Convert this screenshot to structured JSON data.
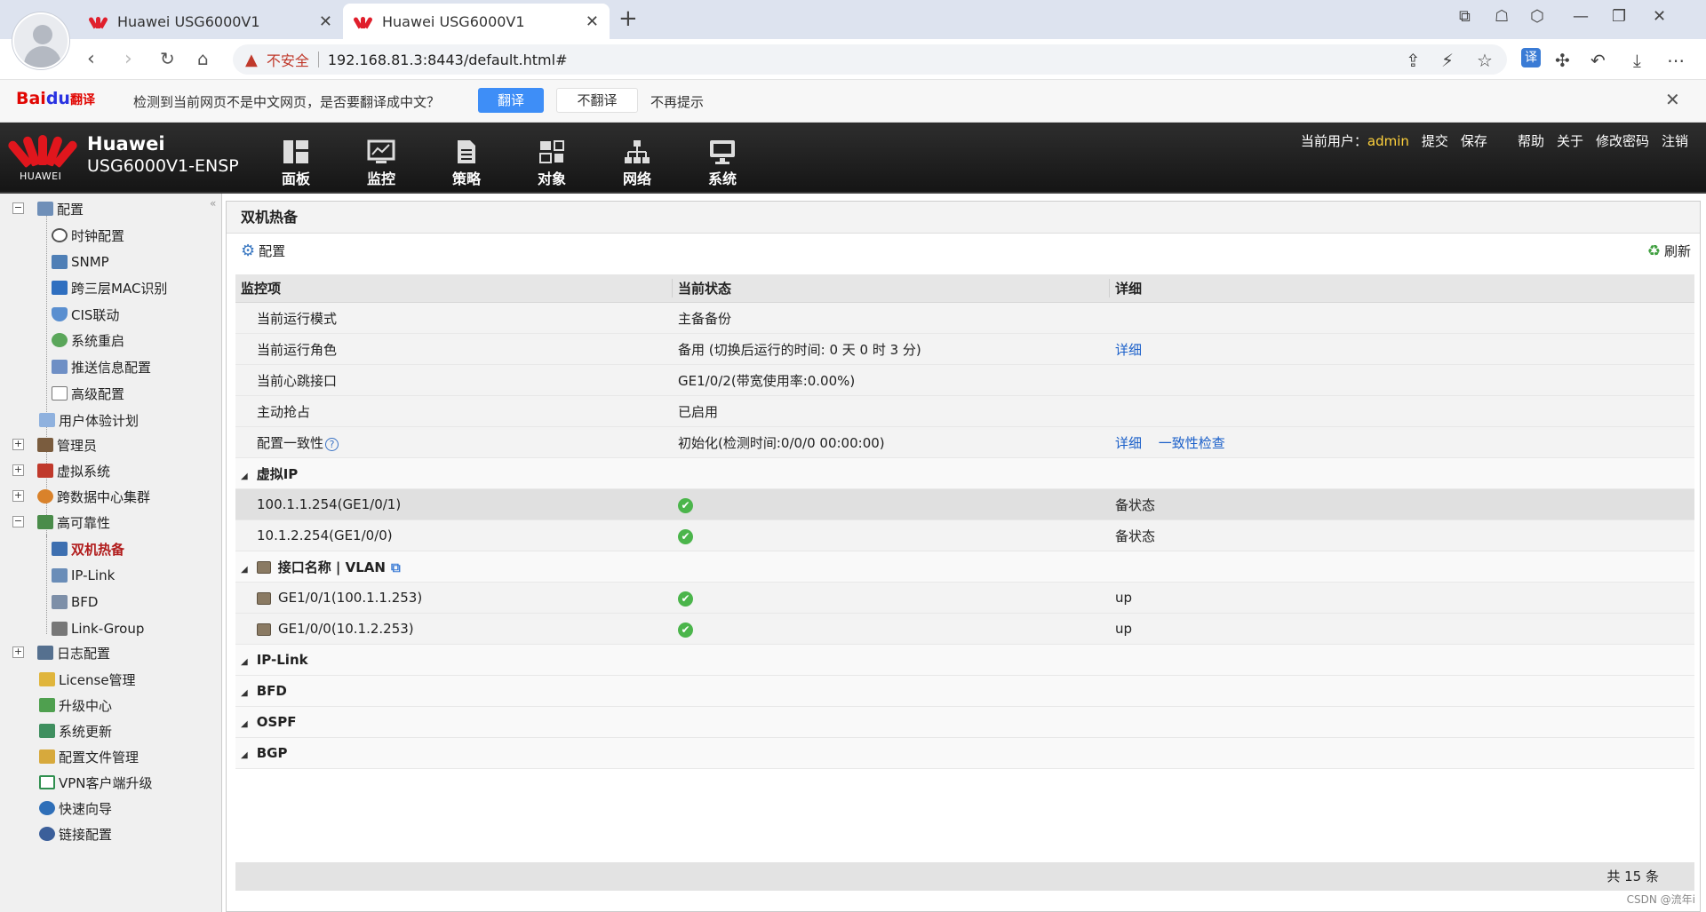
{
  "browser": {
    "tabs": [
      {
        "title": "Huawei USG6000V1",
        "active": false
      },
      {
        "title": "Huawei USG6000V1",
        "active": true
      }
    ],
    "insecure_label": "不安全",
    "url": "192.168.81.3:8443/default.html#",
    "translate_badge": "译"
  },
  "translate_bar": {
    "logo_a": "Bai",
    "logo_b": "du",
    "logo_c": "翻译",
    "message": "检测到当前网页不是中文网页，是否要翻译成中文？",
    "translate_btn": "翻译",
    "no_translate_btn": "不翻译",
    "never_btn": "不再提示"
  },
  "app_header": {
    "logo_text": "HUAWEI",
    "brand_line1": "Huawei",
    "brand_line2": "USG6000V1-ENSP",
    "nav": [
      "面板",
      "监控",
      "策略",
      "对象",
      "网络",
      "系统"
    ],
    "user_label": "当前用户：",
    "user_name": "admin",
    "actions": [
      "提交",
      "保存",
      "帮助",
      "关于",
      "修改密码",
      "注销"
    ]
  },
  "sidebar": {
    "items": [
      {
        "label": "配置",
        "level": 0,
        "toggle": "−"
      },
      {
        "label": "时钟配置",
        "level": 1
      },
      {
        "label": "SNMP",
        "level": 1
      },
      {
        "label": "跨三层MAC识别",
        "level": 1
      },
      {
        "label": "CIS联动",
        "level": 1
      },
      {
        "label": "系统重启",
        "level": 1
      },
      {
        "label": "推送信息配置",
        "level": 1
      },
      {
        "label": "高级配置",
        "level": 1
      },
      {
        "label": "用户体验计划",
        "level": 0
      },
      {
        "label": "管理员",
        "level": 0,
        "toggle": "+"
      },
      {
        "label": "虚拟系统",
        "level": 0,
        "toggle": "+"
      },
      {
        "label": "跨数据中心集群",
        "level": 0,
        "toggle": "+"
      },
      {
        "label": "高可靠性",
        "level": 0,
        "toggle": "−"
      },
      {
        "label": "双机热备",
        "level": 1,
        "selected": true
      },
      {
        "label": "IP-Link",
        "level": 1
      },
      {
        "label": "BFD",
        "level": 1
      },
      {
        "label": "Link-Group",
        "level": 1
      },
      {
        "label": "日志配置",
        "level": 0,
        "toggle": "+"
      },
      {
        "label": "License管理",
        "level": 0
      },
      {
        "label": "升级中心",
        "level": 0
      },
      {
        "label": "系统更新",
        "level": 0
      },
      {
        "label": "配置文件管理",
        "level": 0
      },
      {
        "label": "VPN客户端升级",
        "level": 0
      },
      {
        "label": "快速向导",
        "level": 0
      },
      {
        "label": "链接配置",
        "level": 0
      }
    ]
  },
  "main": {
    "title": "双机热备",
    "config_btn": "配置",
    "refresh_btn": "刷新",
    "columns": [
      "监控项",
      "当前状态",
      "详细"
    ],
    "rows": {
      "mode": {
        "name": "当前运行模式",
        "status": "主备备份"
      },
      "role": {
        "name": "当前运行角色",
        "status": "备用 (切换后运行的时间: 0 天 0 时 3 分)",
        "link": "详细"
      },
      "heartbeat": {
        "name": "当前心跳接口",
        "status": "GE1/0/2(带宽使用率:0.00%)"
      },
      "preempt": {
        "name": "主动抢占",
        "status": "已启用"
      },
      "consistency": {
        "name": "配置一致性",
        "status": "初始化(检测时间:0/0/0 00:00:00)",
        "link1": "详细",
        "link2": "一致性检查"
      }
    },
    "groups": {
      "vip": "虚拟IP",
      "iface": "接口名称 | VLAN",
      "iplink": "IP-Link",
      "bfd": "BFD",
      "ospf": "OSPF",
      "bgp": "BGP"
    },
    "vip_rows": [
      {
        "name": "100.1.1.254(GE1/0/1)",
        "detail": "备状态"
      },
      {
        "name": "10.1.2.254(GE1/0/0)",
        "detail": "备状态"
      }
    ],
    "iface_rows": [
      {
        "name": "GE1/0/1(100.1.1.253)",
        "detail": "up"
      },
      {
        "name": "GE1/0/0(10.1.2.253)",
        "detail": "up"
      }
    ],
    "footer": "共 15 条"
  },
  "watermark": "CSDN @流年i"
}
